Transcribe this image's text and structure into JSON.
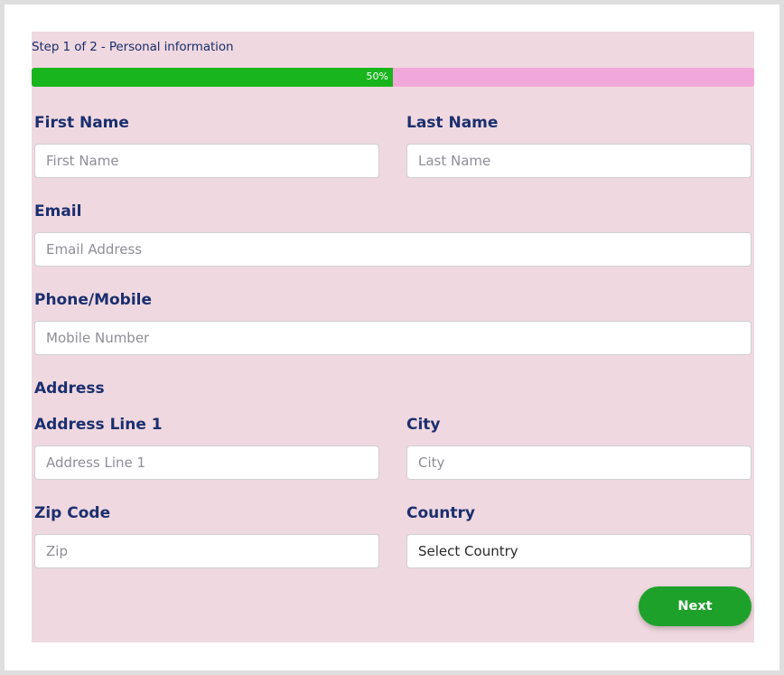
{
  "header": {
    "step_text": "Step 1 of 2 - Personal information"
  },
  "progress": {
    "percent": 50,
    "label": "50%",
    "fill_color": "#18b51c",
    "track_color": "#f1a7d9"
  },
  "fields": {
    "first_name": {
      "label": "First Name",
      "placeholder": "First Name",
      "value": ""
    },
    "last_name": {
      "label": "Last Name",
      "placeholder": "Last Name",
      "value": ""
    },
    "email": {
      "label": "Email",
      "placeholder": "Email Address",
      "value": ""
    },
    "phone": {
      "label": "Phone/Mobile",
      "placeholder": "Mobile Number",
      "value": ""
    },
    "address_section": "Address",
    "address_line1": {
      "label": "Address Line 1",
      "placeholder": "Address Line 1",
      "value": ""
    },
    "city": {
      "label": "City",
      "placeholder": "City",
      "value": ""
    },
    "zip": {
      "label": "Zip Code",
      "placeholder": "Zip",
      "value": ""
    },
    "country": {
      "label": "Country",
      "selected": "Select Country"
    }
  },
  "actions": {
    "next_label": "Next",
    "button_color": "#1ea12a"
  },
  "colors": {
    "form_background": "#efd8e0",
    "label_color": "#1b2f6e"
  }
}
